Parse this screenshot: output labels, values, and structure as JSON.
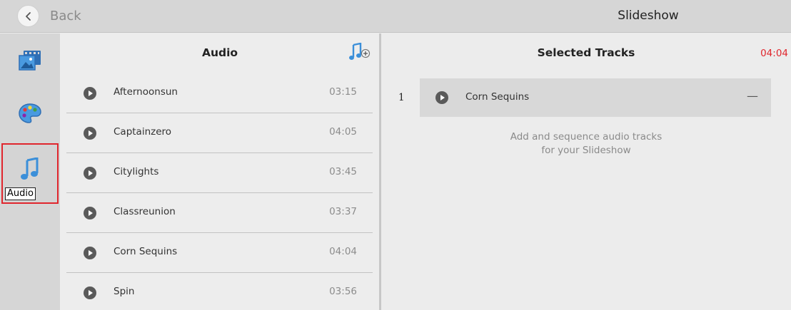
{
  "header": {
    "back_label": "Back",
    "title": "Slideshow"
  },
  "rail": {
    "items": [
      {
        "id": "media",
        "icon": "media-icon"
      },
      {
        "id": "theme",
        "icon": "palette-icon"
      },
      {
        "id": "audio",
        "icon": "music-note-icon",
        "label": "Audio",
        "selected": true
      }
    ]
  },
  "library": {
    "title": "Audio",
    "add_icon": "add-music-icon",
    "tracks": [
      {
        "name": "Afternoonsun",
        "duration": "03:15"
      },
      {
        "name": "Captainzero",
        "duration": "04:05"
      },
      {
        "name": "Citylights",
        "duration": "03:45"
      },
      {
        "name": "Classreunion",
        "duration": "03:37"
      },
      {
        "name": "Corn Sequins",
        "duration": "04:04"
      },
      {
        "name": "Spin",
        "duration": "03:56"
      }
    ]
  },
  "selected": {
    "title": "Selected Tracks",
    "total_duration": "04:04",
    "tracks": [
      {
        "index": "1",
        "name": "Corn Sequins",
        "remove_label": "—"
      }
    ],
    "hint_line1": "Add and sequence audio tracks",
    "hint_line2": "for your Slideshow"
  },
  "colors": {
    "accent": "#3b8fd9",
    "highlight": "#e0262d"
  }
}
